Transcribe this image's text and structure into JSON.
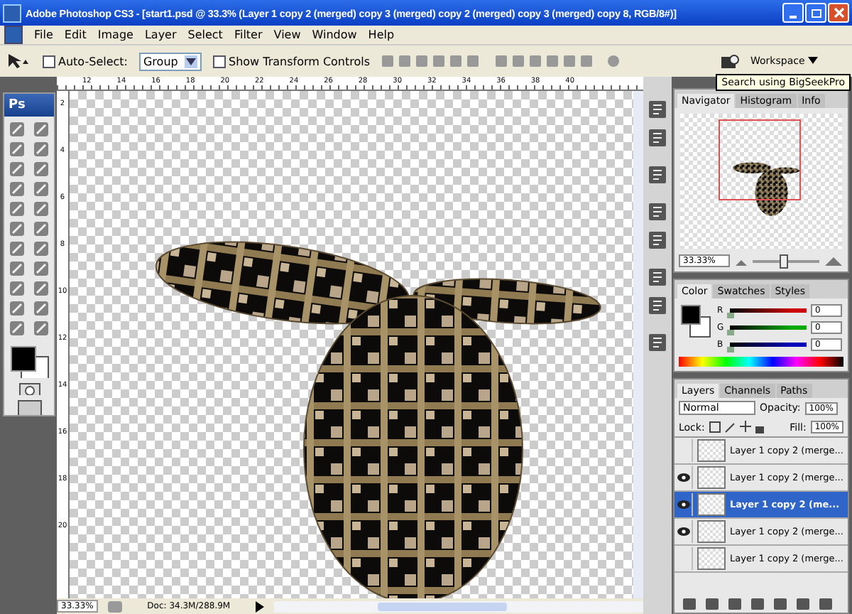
{
  "window": {
    "title": "Adobe Photoshop CS3 - [start1.psd @ 33.3% (Layer 1 copy 2 (merged) copy 3 (merged) copy 2 (merged) copy 3 (merged) copy 8, RGB/8#)]"
  },
  "menu": [
    "File",
    "Edit",
    "Image",
    "Layer",
    "Select",
    "Filter",
    "View",
    "Window",
    "Help"
  ],
  "options_bar": {
    "auto_select": {
      "label": "Auto-Select:",
      "checked": false
    },
    "target": "Group",
    "transform_controls": {
      "label": "Show Transform Controls",
      "checked": false
    },
    "workspace": "Workspace",
    "tooltip": "Search using BigSeekPro"
  },
  "toolbox": {
    "logo": "Ps"
  },
  "document": {
    "top_ruler": [
      "12",
      "14",
      "16",
      "18",
      "20",
      "22",
      "24",
      "26",
      "28",
      "30",
      "32",
      "34",
      "36",
      "38",
      "40"
    ],
    "left_ruler": [
      "2",
      "4",
      "6",
      "8",
      "10",
      "12",
      "14",
      "16",
      "18",
      "20"
    ],
    "zoom": "33.33%",
    "doc_size": "Doc: 34.3M/288.9M"
  },
  "navigator": {
    "tabs": [
      {
        "label": "Navigator",
        "selected": true
      },
      {
        "label": "Histogram",
        "selected": false
      },
      {
        "label": "Info",
        "selected": false
      }
    ],
    "zoom": "33.33%",
    "level": 0.45
  },
  "color": {
    "tabs": [
      {
        "label": "Color",
        "selected": true
      },
      {
        "label": "Swatches",
        "selected": false
      },
      {
        "label": "Styles",
        "selected": false
      }
    ],
    "channels": [
      {
        "label": "R",
        "value": "0",
        "level": 0,
        "color": "#cc0000"
      },
      {
        "label": "G",
        "value": "0",
        "level": 0,
        "color": "#00aa00"
      },
      {
        "label": "B",
        "value": "0",
        "level": 0,
        "color": "#0000bb"
      }
    ]
  },
  "layers": {
    "tabs": [
      {
        "label": "Layers",
        "selected": true
      },
      {
        "label": "Channels",
        "selected": false
      },
      {
        "label": "Paths",
        "selected": false
      }
    ],
    "blend_mode": "Normal",
    "opacity_label": "Opacity:",
    "opacity": "100%",
    "lock_label": "Lock:",
    "fill_label": "Fill:",
    "fill": "100%",
    "items": [
      {
        "name": "Layer 1 copy 2 (merge...",
        "visible": false,
        "selected": false
      },
      {
        "name": "Layer 1 copy 2 (merge...",
        "visible": true,
        "selected": false
      },
      {
        "name": "Layer 1 copy 2 (me...",
        "visible": true,
        "selected": true
      },
      {
        "name": "Layer 1 copy 2 (merge...",
        "visible": true,
        "selected": false
      },
      {
        "name": "Layer 1 copy 2 (merge...",
        "visible": false,
        "selected": false
      }
    ]
  }
}
